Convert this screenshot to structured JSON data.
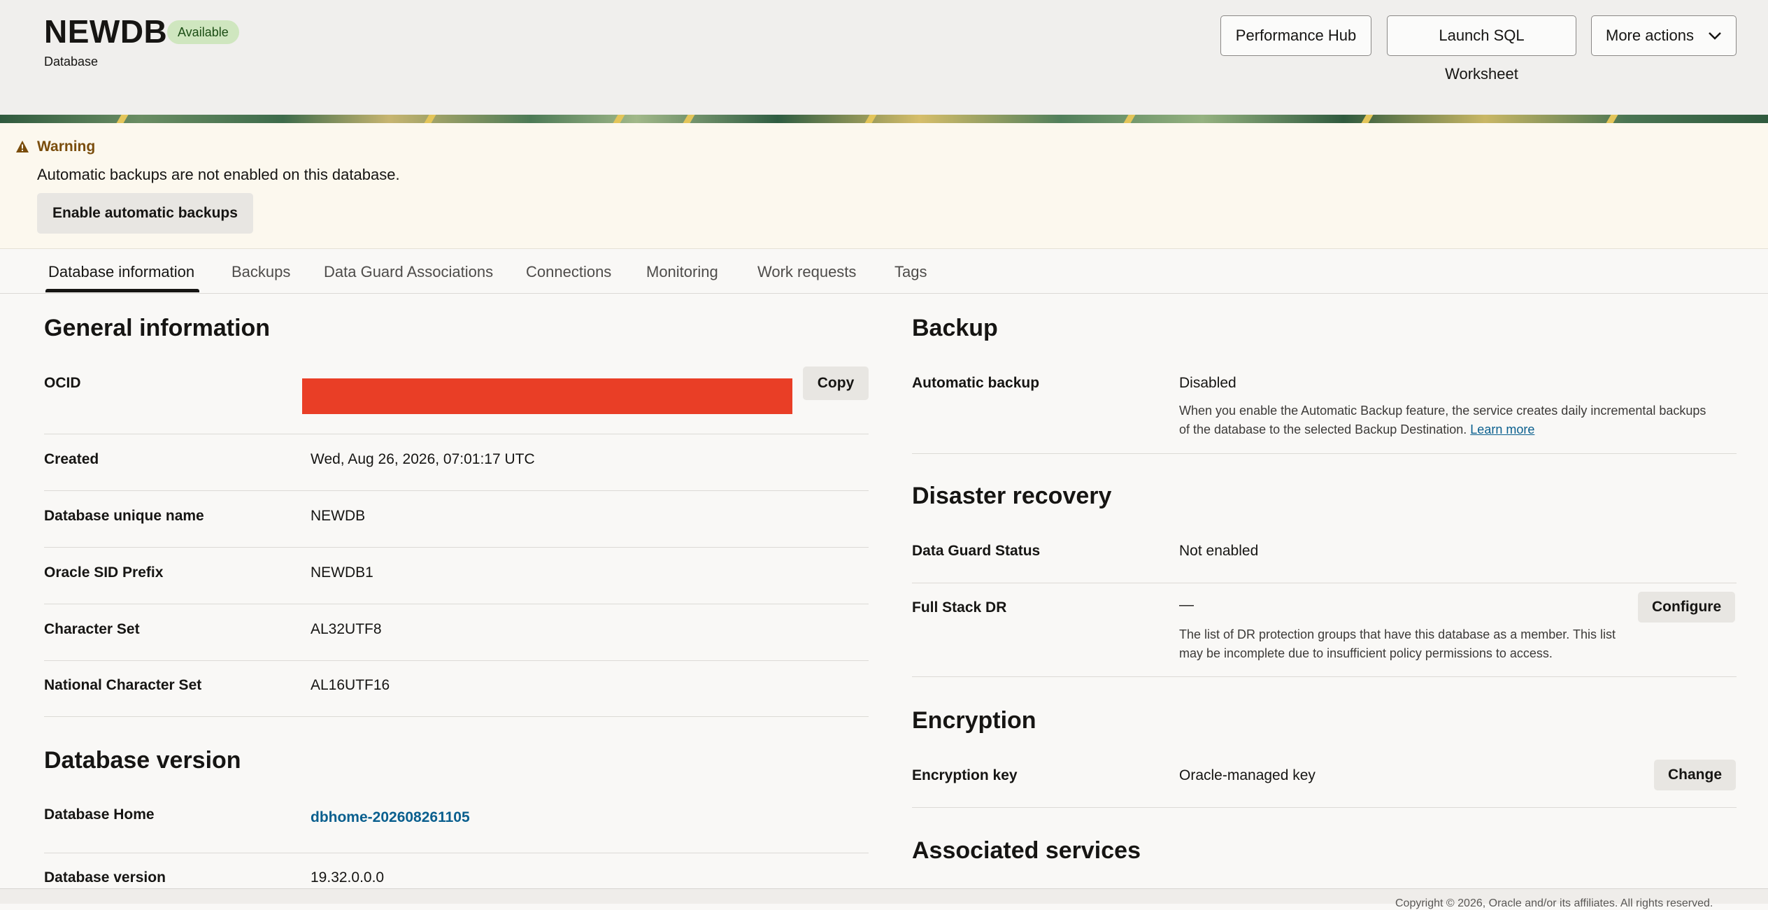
{
  "header": {
    "title": "NEWDB",
    "status_badge": "Available",
    "subtitle": "Database",
    "buttons": {
      "performance_hub": "Performance Hub",
      "launch_sql": "Launch SQL Worksheet",
      "more_actions": "More actions"
    }
  },
  "warning": {
    "title": "Warning",
    "message": "Automatic backups are not enabled on this database.",
    "button": "Enable automatic backups"
  },
  "tabs": [
    {
      "label": "Database information",
      "active": true
    },
    {
      "label": "Backups"
    },
    {
      "label": "Data Guard Associations"
    },
    {
      "label": "Connections"
    },
    {
      "label": "Monitoring"
    },
    {
      "label": "Work requests"
    },
    {
      "label": "Tags"
    }
  ],
  "general": {
    "title": "General information",
    "ocid_label": "OCID",
    "copy": "Copy",
    "created_label": "Created",
    "created_value": "Wed, Aug 26, 2026, 07:01:17 UTC",
    "unique_name_label": "Database unique name",
    "unique_name_value": "NEWDB",
    "sid_label": "Oracle SID Prefix",
    "sid_value": "NEWDB1",
    "charset_label": "Character Set",
    "charset_value": "AL32UTF8",
    "ncharset_label": "National Character Set",
    "ncharset_value": "AL16UTF16"
  },
  "version": {
    "title": "Database version",
    "home_label": "Database Home",
    "home_value": "dbhome-202608261105",
    "version_label": "Database version",
    "version_value": "19.32.0.0.0"
  },
  "backup": {
    "title": "Backup",
    "auto_label": "Automatic backup",
    "auto_value": "Disabled",
    "desc_line1": "When you enable the Automatic Backup feature, the service creates daily incremental backups",
    "desc_line2": "of the database to the selected Backup Destination.",
    "learn_more": "Learn more"
  },
  "dr": {
    "title": "Disaster recovery",
    "dg_label": "Data Guard Status",
    "dg_value": "Not enabled",
    "fsdr_label": "Full Stack DR",
    "fsdr_value": "—",
    "fsdr_desc_line1": "The list of DR protection groups that have this database as a member. This list",
    "fsdr_desc_line2": "may be incomplete due to insufficient policy permissions to access.",
    "configure": "Configure"
  },
  "encryption": {
    "title": "Encryption",
    "key_label": "Encryption key",
    "key_value": "Oracle-managed key",
    "change": "Change"
  },
  "associated": {
    "title": "Associated services"
  },
  "footer": {
    "text": "Copyright © 2026, Oracle and/or its affiliates. All rights reserved."
  },
  "colors": {
    "accent_link": "#0a5f8e",
    "badge_bg": "#cfe6bf",
    "warning_bg": "#fcf8ee",
    "redaction": "#e93e26"
  },
  "icons": [
    "warning-icon",
    "chevron-down-icon"
  ]
}
